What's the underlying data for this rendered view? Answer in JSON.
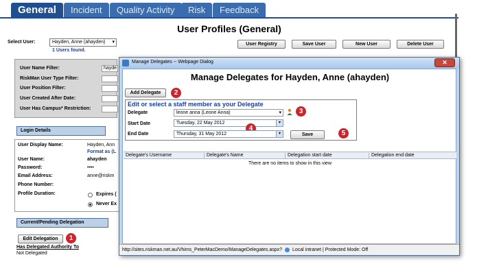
{
  "tabs": [
    {
      "label": "General",
      "active": true
    },
    {
      "label": "Incident"
    },
    {
      "label": "Quality Activity"
    },
    {
      "label": "Risk"
    },
    {
      "label": "Feedback"
    }
  ],
  "page": {
    "title": "User Profiles (General)",
    "select_user_label": "Select User:",
    "select_user_value": "Hayden, Anne (ahayden)",
    "users_found": "1 Users found.",
    "buttons": {
      "registry": "User Registry",
      "save": "Save User",
      "new": "New User",
      "delete": "Delete User"
    }
  },
  "filters": {
    "name_filter": "User Name Filter:",
    "name_filter_value": "hayde",
    "type_filter": "RiskMan User Type Filter:",
    "position_filter": "User Position Filter:",
    "created_after": "User Created After Date:",
    "campus_restriction": "User Has Campus* Restriction:"
  },
  "login_details": {
    "heading": "Login Details",
    "display_name_label": "User Display Name:",
    "display_name_value": "Hayden, Ann",
    "format_hint": "Format as (L",
    "username_label": "User Name:",
    "username_value": "ahayden",
    "password_label": "Password:",
    "password_value": "••••",
    "email_label": "Email Address:",
    "email_value": "anne@riskm",
    "phone_label": "Phone Number:",
    "profile_duration_label": "Profile Duration:",
    "expires_option": "Expires (",
    "never_option": "Never Ex"
  },
  "delegation": {
    "heading": "Current/Pending Delegation",
    "edit_button": "Edit Delegation",
    "authority_label": "Has Delegated Authority To",
    "authority_value": "Not Delegated"
  },
  "dialog": {
    "window_title": "Manage Delegates -- Webpage Dialog",
    "heading": "Manage Delegates for Hayden, Anne (ahayden)",
    "add_button": "Add Delegate",
    "edit_title": "Edit or select a staff member as your Delegate",
    "delegate_label": "Delegate",
    "delegate_value": "leone anna (Leone Anna)",
    "start_label": "Start Date",
    "start_value": "Tuesday, 22 May 2012",
    "end_label": "End Date",
    "end_value": "Thursday, 31 May 2012",
    "save_button": "Save",
    "columns": [
      "Delegate's Username",
      "Delegate's Name",
      "Delegation start date",
      "Delegation end date"
    ],
    "empty_text": "There are no items to show in this view",
    "status_url": "http://sites.riskman.net.au/Vhims_PeterMacDemo/ManageDelegates.aspx?",
    "status_zone": "Local intranet | Protected Mode: Off"
  },
  "callouts": [
    "1",
    "2",
    "3",
    "4",
    "5"
  ],
  "colors": {
    "tab_active": "#1f4f91",
    "callout": "#c8262c",
    "link": "#1b3fa0"
  }
}
